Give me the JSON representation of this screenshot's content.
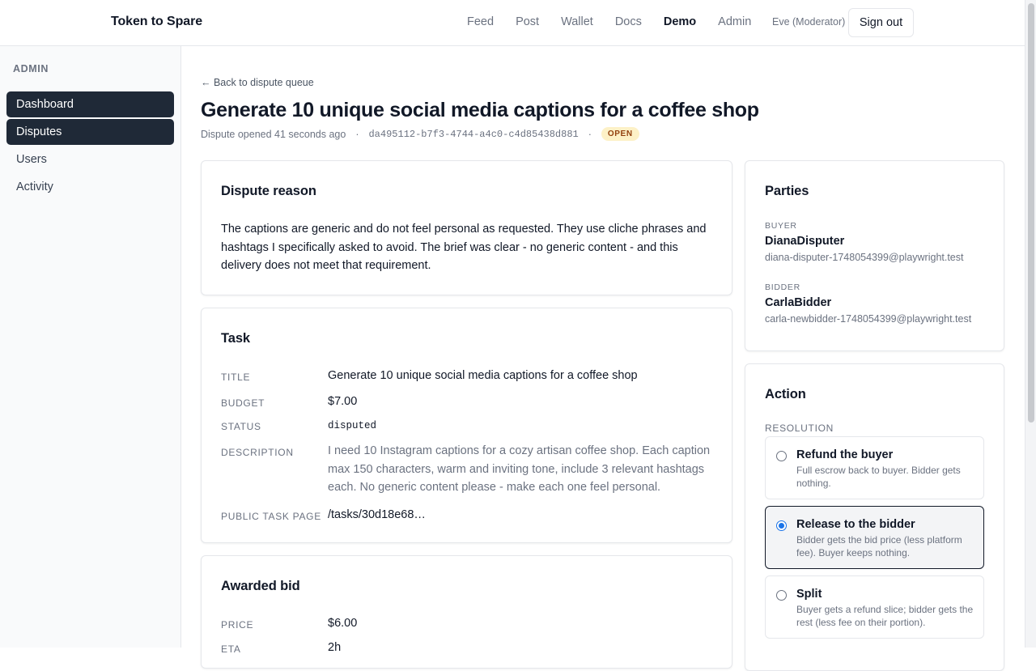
{
  "app": {
    "brand": "Token to Spare"
  },
  "nav": {
    "items": [
      "Feed",
      "Post",
      "Wallet",
      "Docs",
      "Demo",
      "Admin"
    ],
    "active": "Demo",
    "user_label": "Eve (Moderator)",
    "signout_label": "Sign out"
  },
  "sidebar": {
    "heading": "ADMIN",
    "items": [
      "Dashboard",
      "Disputes",
      "Users",
      "Activity"
    ]
  },
  "page": {
    "back_label": "← Back to dispute queue",
    "title": "Generate 10 unique social media captions for a coffee shop",
    "opened": "Dispute opened 41 seconds ago",
    "sep": "·",
    "dispute_id": "da495112-b7f3-4744-a4c0-c4d85438d881",
    "status_badge": "OPEN"
  },
  "dispute_reason": {
    "title": "Dispute reason",
    "text": "The captions are generic and do not feel personal as requested. They use cliche phrases and hashtags I specifically asked to avoid. The brief was clear - no generic content - and this delivery does not meet that requirement."
  },
  "task": {
    "title": "Task",
    "labels": {
      "title": "TITLE",
      "budget": "BUDGET",
      "status": "STATUS",
      "description": "DESCRIPTION",
      "public_page": "PUBLIC TASK PAGE"
    },
    "values": {
      "title": "Generate 10 unique social media captions for a coffee shop",
      "budget": "$7.00",
      "status": "disputed",
      "description": "I need 10 Instagram captions for a cozy artisan coffee shop. Each caption max 150 characters, warm and inviting tone, include 3 relevant hashtags each. No generic content please - make each one feel personal.",
      "public_page": "/tasks/30d18e68…"
    }
  },
  "awarded_bid": {
    "title": "Awarded bid",
    "labels": {
      "price": "PRICE",
      "eta": "ETA"
    },
    "values": {
      "price": "$6.00",
      "eta": "2h"
    }
  },
  "parties": {
    "title": "Parties",
    "buyer": {
      "label": "BUYER",
      "name": "DianaDisputer",
      "email": "diana-disputer-1748054399@playwright.test"
    },
    "bidder": {
      "label": "BIDDER",
      "name": "CarlaBidder",
      "email": "carla-newbidder-1748054399@playwright.test"
    }
  },
  "action": {
    "title": "Action",
    "resolution_label": "RESOLUTION",
    "options": [
      {
        "title": "Refund the buyer",
        "desc": "Full escrow back to buyer. Bidder gets nothing.",
        "selected": false
      },
      {
        "title": "Release to the bidder",
        "desc": "Bidder gets the bid price (less platform fee). Buyer keeps nothing.",
        "selected": true
      },
      {
        "title": "Split",
        "desc": "Buyer gets a refund slice; bidder gets the rest (less fee on their portion).",
        "selected": false
      }
    ]
  },
  "colors": {
    "accent_dark": "#1f2937",
    "badge_bg": "#fdf1c7",
    "badge_text": "#92400e",
    "radio_selected": "#1a73e8"
  }
}
